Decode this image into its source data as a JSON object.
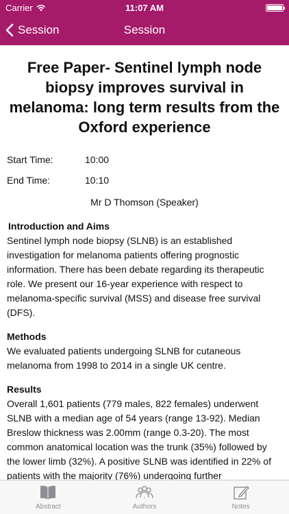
{
  "status": {
    "carrier": "Carrier",
    "time": "11:07 AM"
  },
  "nav": {
    "back_label": "Session",
    "title": "Session"
  },
  "paper": {
    "title": "Free Paper- Sentinel lymph node biopsy improves survival in melanoma: long term results from the Oxford experience",
    "start_label": "Start Time:",
    "start_value": "10:00",
    "end_label": "End Time:",
    "end_value": "10:10",
    "speaker": "Mr D Thomson (Speaker)"
  },
  "sections": [
    {
      "heading": "Introduction and Aims",
      "body": "Sentinel lymph node biopsy (SLNB) is an established investigation for melanoma patients offering prognostic information. There has been debate regarding its therapeutic role. We present our 16-year experience with respect to melanoma-specific survival (MSS) and disease free survival (DFS)."
    },
    {
      "heading": "Methods",
      "body": "We evaluated patients undergoing SLNB for cutaneous melanoma from 1998 to 2014 in a single UK centre."
    },
    {
      "heading": "Results",
      "body": "Overall 1,601 patients (779 males, 822 females) underwent SLNB with a median age of 54 years (range 13-92). Median Breslow thickness was 2.00mm (range 0.3-20). The most common anatomical location was the trunk (35%) followed by the lower limb (32%). A positive SLNB was identified in 22% of patients with the majority (76%) undergoing further"
    }
  ],
  "tabs": [
    {
      "label": "Abstract",
      "icon": "book-icon"
    },
    {
      "label": "Authors",
      "icon": "people-icon"
    },
    {
      "label": "Notes",
      "icon": "compose-icon"
    }
  ],
  "colors": {
    "brand": "#a61a6a",
    "tab_inactive": "#8e8e93"
  }
}
